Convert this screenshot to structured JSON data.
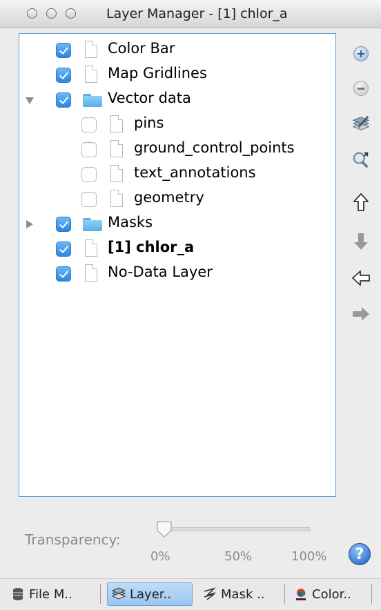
{
  "window": {
    "title": "Layer Manager - [1] chlor_a"
  },
  "layers": [
    {
      "label": "Color Bar",
      "checked": true,
      "icon": "document-icon",
      "level": 0,
      "bold": false
    },
    {
      "label": "Map Gridlines",
      "checked": true,
      "icon": "document-icon",
      "level": 0,
      "bold": false
    },
    {
      "label": "Vector data",
      "checked": true,
      "icon": "folder-icon",
      "level": 0,
      "expanded": true,
      "bold": false
    },
    {
      "label": "pins",
      "checked": false,
      "icon": "document-icon",
      "level": 1,
      "bold": false
    },
    {
      "label": "ground_control_points",
      "checked": false,
      "icon": "document-icon",
      "level": 1,
      "bold": false
    },
    {
      "label": "text_annotations",
      "checked": false,
      "icon": "document-icon",
      "level": 1,
      "bold": false
    },
    {
      "label": "geometry",
      "checked": false,
      "icon": "document-icon",
      "level": 1,
      "bold": false
    },
    {
      "label": "Masks",
      "checked": true,
      "icon": "folder-icon",
      "level": 0,
      "expanded": false,
      "bold": false
    },
    {
      "label": "[1] chlor_a",
      "checked": true,
      "icon": "document-icon",
      "level": 0,
      "bold": true
    },
    {
      "label": "No-Data Layer",
      "checked": true,
      "icon": "document-icon",
      "level": 0,
      "bold": false
    }
  ],
  "toolbar": [
    {
      "icon": "add-layer-icon",
      "enabled": true
    },
    {
      "icon": "remove-layer-icon",
      "enabled": true
    },
    {
      "icon": "edit-layer-icon",
      "enabled": true
    },
    {
      "icon": "zoom-to-layer-icon",
      "enabled": true
    },
    {
      "icon": "move-up-icon",
      "enabled": true
    },
    {
      "icon": "move-down-icon",
      "enabled": false
    },
    {
      "icon": "move-left-icon",
      "enabled": true
    },
    {
      "icon": "move-right-icon",
      "enabled": false
    }
  ],
  "transparency": {
    "label": "Transparency:",
    "value_percent": 0,
    "ticks": [
      "0%",
      "50%",
      "100%"
    ]
  },
  "help": {
    "icon": "help-icon",
    "text": "?"
  },
  "tabs": [
    {
      "label": "File M..",
      "icon": "database-icon",
      "active": false
    },
    {
      "label": "Layer..",
      "icon": "layers-icon",
      "active": true
    },
    {
      "label": "Mask ..",
      "icon": "mask-icon",
      "active": false
    },
    {
      "label": "Color..",
      "icon": "color-manipulation-icon",
      "active": false
    }
  ],
  "colors": {
    "accent": "#2b86e3",
    "selection_border": "#5b9fdb",
    "folder": "#6cbdf0",
    "disabled_text": "#8a8a8a"
  }
}
